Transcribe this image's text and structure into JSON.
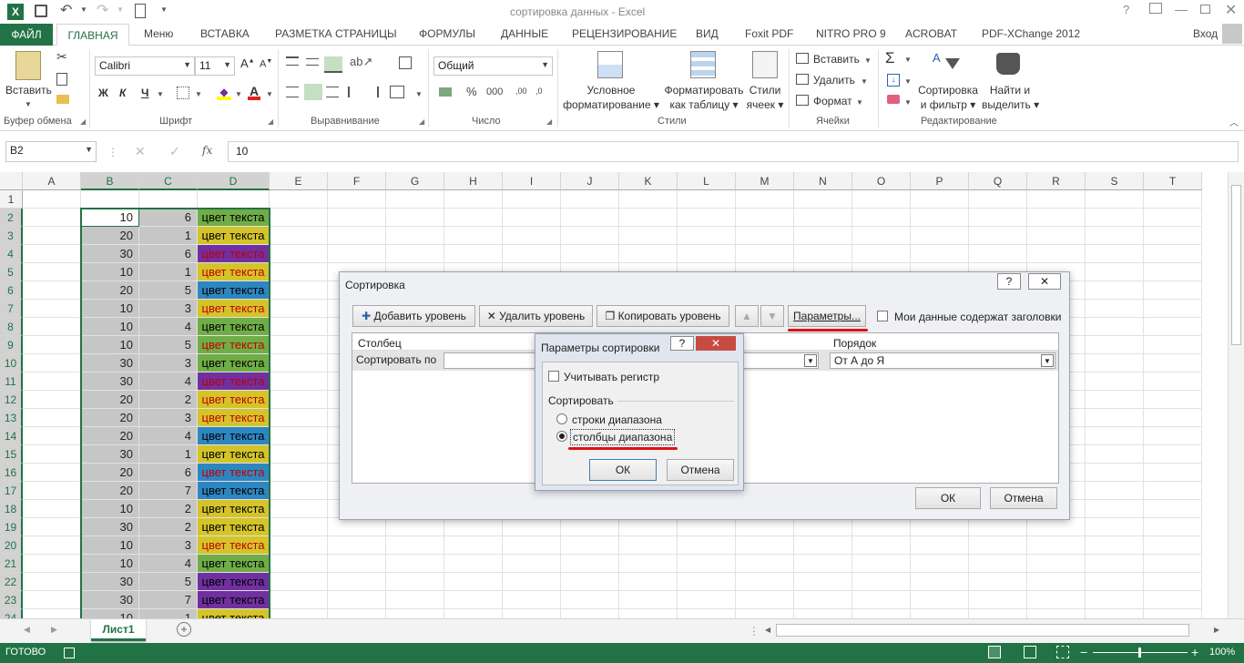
{
  "window": {
    "title": "сортировка данных - Excel",
    "signin": "Вход"
  },
  "tabs": [
    "ФАЙЛ",
    "ГЛАВНАЯ",
    "Меню",
    "ВСТАВКА",
    "РАЗМЕТКА СТРАНИЦЫ",
    "ФОРМУЛЫ",
    "ДАННЫЕ",
    "РЕЦЕНЗИРОВАНИЕ",
    "ВИД",
    "Foxit PDF",
    "NITRO PRO 9",
    "ACROBAT",
    "PDF-XChange 2012"
  ],
  "ribbon": {
    "paste": "Вставить",
    "font_name": "Calibri",
    "font_size": "11",
    "bold": "Ж",
    "italic": "К",
    "underline": "Ч",
    "number_format": "Общий",
    "cond_format": [
      "Условное",
      "форматирование"
    ],
    "format_table": [
      "Форматировать",
      "как таблицу"
    ],
    "cell_styles": [
      "Стили",
      "ячеек"
    ],
    "insert": "Вставить",
    "delete": "Удалить",
    "format": "Формат",
    "sort_filter": [
      "Сортировка",
      "и фильтр"
    ],
    "find_select": [
      "Найти и",
      "выделить"
    ],
    "groups": [
      "Буфер обмена",
      "Шрифт",
      "Выравнивание",
      "Число",
      "Стили",
      "Ячейки",
      "Редактирование"
    ]
  },
  "formula_bar": {
    "name_box": "B2",
    "fx": "fx",
    "value": "10"
  },
  "columns": [
    "A",
    "B",
    "C",
    "D",
    "E",
    "F",
    "G",
    "H",
    "I",
    "J",
    "K",
    "L",
    "M",
    "N",
    "O",
    "P",
    "Q",
    "R",
    "S",
    "T"
  ],
  "rows": [
    {
      "n": "1",
      "b": "",
      "c": "",
      "d": ""
    },
    {
      "n": "2",
      "b": "10",
      "c": "6",
      "d": "цвет текста"
    },
    {
      "n": "3",
      "b": "20",
      "c": "1",
      "d": "цвет текста"
    },
    {
      "n": "4",
      "b": "30",
      "c": "6",
      "d": "цвет текста"
    },
    {
      "n": "5",
      "b": "10",
      "c": "1",
      "d": "цвет текста"
    },
    {
      "n": "6",
      "b": "20",
      "c": "5",
      "d": "цвет текста"
    },
    {
      "n": "7",
      "b": "10",
      "c": "3",
      "d": "цвет текста"
    },
    {
      "n": "8",
      "b": "10",
      "c": "4",
      "d": "цвет текста"
    },
    {
      "n": "9",
      "b": "10",
      "c": "5",
      "d": "цвет текста"
    },
    {
      "n": "10",
      "b": "30",
      "c": "3",
      "d": "цвет текста"
    },
    {
      "n": "11",
      "b": "30",
      "c": "4",
      "d": "цвет текста"
    },
    {
      "n": "12",
      "b": "20",
      "c": "2",
      "d": "цвет текста"
    },
    {
      "n": "13",
      "b": "20",
      "c": "3",
      "d": "цвет текста"
    },
    {
      "n": "14",
      "b": "20",
      "c": "4",
      "d": "цвет текста"
    },
    {
      "n": "15",
      "b": "30",
      "c": "1",
      "d": "цвет текста"
    },
    {
      "n": "16",
      "b": "20",
      "c": "6",
      "d": "цвет текста"
    },
    {
      "n": "17",
      "b": "20",
      "c": "7",
      "d": "цвет текста"
    },
    {
      "n": "18",
      "b": "10",
      "c": "2",
      "d": "цвет текста"
    },
    {
      "n": "19",
      "b": "30",
      "c": "2",
      "d": "цвет текста"
    },
    {
      "n": "20",
      "b": "10",
      "c": "3",
      "d": "цвет текста"
    },
    {
      "n": "21",
      "b": "10",
      "c": "4",
      "d": "цвет текста"
    },
    {
      "n": "22",
      "b": "30",
      "c": "5",
      "d": "цвет текста"
    },
    {
      "n": "23",
      "b": "30",
      "c": "7",
      "d": "цвет текста"
    },
    {
      "n": "24",
      "b": "10",
      "c": "1",
      "d": "цвет текста"
    }
  ],
  "d_styles": [
    {
      "bg": "#ffffff",
      "fg": "#000000"
    },
    {
      "bg": "#70ad47",
      "fg": "#000000"
    },
    {
      "bg": "#d4c42a",
      "fg": "#000000"
    },
    {
      "bg": "#7030a0",
      "fg": "#c00000"
    },
    {
      "bg": "#d4c42a",
      "fg": "#c00000"
    },
    {
      "bg": "#2e86c1",
      "fg": "#000000"
    },
    {
      "bg": "#d4c42a",
      "fg": "#c00000"
    },
    {
      "bg": "#70ad47",
      "fg": "#000000"
    },
    {
      "bg": "#70ad47",
      "fg": "#c00000"
    },
    {
      "bg": "#70ad47",
      "fg": "#000000"
    },
    {
      "bg": "#7030a0",
      "fg": "#c00000"
    },
    {
      "bg": "#d4c42a",
      "fg": "#c00000"
    },
    {
      "bg": "#d4c42a",
      "fg": "#c00000"
    },
    {
      "bg": "#2e86c1",
      "fg": "#000000"
    },
    {
      "bg": "#d4c42a",
      "fg": "#000000"
    },
    {
      "bg": "#2e86c1",
      "fg": "#c00000"
    },
    {
      "bg": "#2e86c1",
      "fg": "#000000"
    },
    {
      "bg": "#d4c42a",
      "fg": "#000000"
    },
    {
      "bg": "#d4c42a",
      "fg": "#000000"
    },
    {
      "bg": "#d4c42a",
      "fg": "#c00000"
    },
    {
      "bg": "#70ad47",
      "fg": "#000000"
    },
    {
      "bg": "#7030a0",
      "fg": "#000000"
    },
    {
      "bg": "#7030a0",
      "fg": "#000000"
    },
    {
      "bg": "#d4c42a",
      "fg": "#000000"
    }
  ],
  "sheet": {
    "tab": "Лист1"
  },
  "status": {
    "ready": "ГОТОВО",
    "zoom": "100%"
  },
  "sort_dialog": {
    "title": "Сортировка",
    "add_level": "Добавить уровень",
    "delete_level": "Удалить уровень",
    "copy_level": "Копировать уровень",
    "params": "Параметры...",
    "headers_check": "Мои данные содержат заголовки",
    "col_header": "Столбец",
    "order_header": "Порядок",
    "sort_by": "Сортировать по",
    "order_value": "От А до Я",
    "ok": "ОК",
    "cancel": "Отмена"
  },
  "params_dialog": {
    "title": "Параметры сортировки",
    "case_sensitive": "Учитывать регистр",
    "sort_label": "Сортировать",
    "rows_option": "строки диапазона",
    "cols_option": "столбцы диапазона",
    "ok": "ОК",
    "cancel": "Отмена"
  },
  "colors": {
    "accent": "#217346",
    "selection": "#c6c6c6",
    "annotation": "#e01010"
  }
}
